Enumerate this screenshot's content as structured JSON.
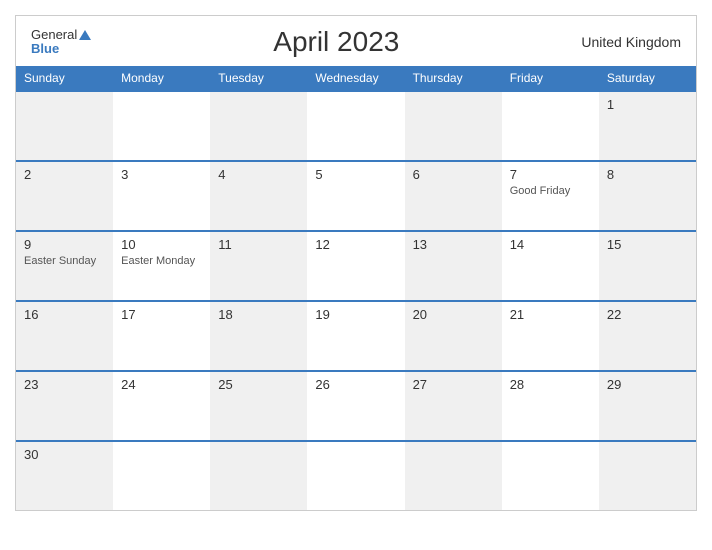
{
  "header": {
    "logo_general": "General",
    "logo_blue": "Blue",
    "title": "April 2023",
    "country": "United Kingdom"
  },
  "dayHeaders": [
    "Sunday",
    "Monday",
    "Tuesday",
    "Wednesday",
    "Thursday",
    "Friday",
    "Saturday"
  ],
  "weeks": [
    {
      "cells": [
        {
          "date": "",
          "event": ""
        },
        {
          "date": "",
          "event": ""
        },
        {
          "date": "",
          "event": ""
        },
        {
          "date": "",
          "event": ""
        },
        {
          "date": "",
          "event": ""
        },
        {
          "date": "",
          "event": ""
        },
        {
          "date": "1",
          "event": ""
        }
      ]
    },
    {
      "cells": [
        {
          "date": "2",
          "event": ""
        },
        {
          "date": "3",
          "event": ""
        },
        {
          "date": "4",
          "event": ""
        },
        {
          "date": "5",
          "event": ""
        },
        {
          "date": "6",
          "event": ""
        },
        {
          "date": "7",
          "event": "Good Friday"
        },
        {
          "date": "8",
          "event": ""
        }
      ]
    },
    {
      "cells": [
        {
          "date": "9",
          "event": "Easter Sunday"
        },
        {
          "date": "10",
          "event": "Easter Monday"
        },
        {
          "date": "11",
          "event": ""
        },
        {
          "date": "12",
          "event": ""
        },
        {
          "date": "13",
          "event": ""
        },
        {
          "date": "14",
          "event": ""
        },
        {
          "date": "15",
          "event": ""
        }
      ]
    },
    {
      "cells": [
        {
          "date": "16",
          "event": ""
        },
        {
          "date": "17",
          "event": ""
        },
        {
          "date": "18",
          "event": ""
        },
        {
          "date": "19",
          "event": ""
        },
        {
          "date": "20",
          "event": ""
        },
        {
          "date": "21",
          "event": ""
        },
        {
          "date": "22",
          "event": ""
        }
      ]
    },
    {
      "cells": [
        {
          "date": "23",
          "event": ""
        },
        {
          "date": "24",
          "event": ""
        },
        {
          "date": "25",
          "event": ""
        },
        {
          "date": "26",
          "event": ""
        },
        {
          "date": "27",
          "event": ""
        },
        {
          "date": "28",
          "event": ""
        },
        {
          "date": "29",
          "event": ""
        }
      ]
    },
    {
      "cells": [
        {
          "date": "30",
          "event": ""
        },
        {
          "date": "",
          "event": ""
        },
        {
          "date": "",
          "event": ""
        },
        {
          "date": "",
          "event": ""
        },
        {
          "date": "",
          "event": ""
        },
        {
          "date": "",
          "event": ""
        },
        {
          "date": "",
          "event": ""
        }
      ]
    }
  ]
}
